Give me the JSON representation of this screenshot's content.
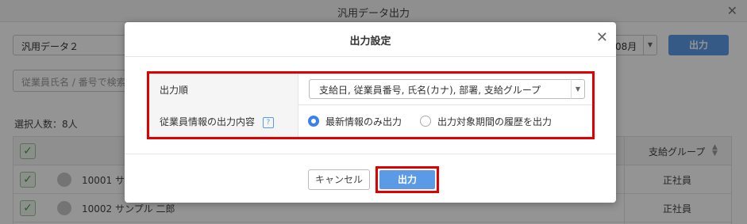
{
  "window": {
    "title": "汎用データ出力"
  },
  "toolbar": {
    "data_select_value": "汎用データ２",
    "month_value": "08月",
    "output_button": "出力"
  },
  "search": {
    "placeholder": "従業員氏名 / 番号で検索"
  },
  "selection": {
    "count_text": "選択人数：8人"
  },
  "table": {
    "columns": [
      "支給グループ"
    ],
    "rows": [
      {
        "id_name": "10001 サ",
        "group": "正社員"
      },
      {
        "id_name": "10002 サンプル 二郎",
        "group": "正社員"
      }
    ]
  },
  "modal": {
    "title": "出力設定",
    "order_label": "出力順",
    "order_value": "支給日, 従業員番号, 氏名(カナ), 部署, 支給グループ",
    "employee_info_label": "従業員情報の出力内容",
    "help_mark": "?",
    "radio_latest": "最新情報のみ出力",
    "radio_history": "出力対象期間の履歴を出力",
    "selected_option": "latest",
    "cancel_button": "キャンセル",
    "submit_button": "出力"
  },
  "colors": {
    "accent": "#5b9be5",
    "highlight_border": "#e00000",
    "radio_selected": "#3b82e6"
  }
}
